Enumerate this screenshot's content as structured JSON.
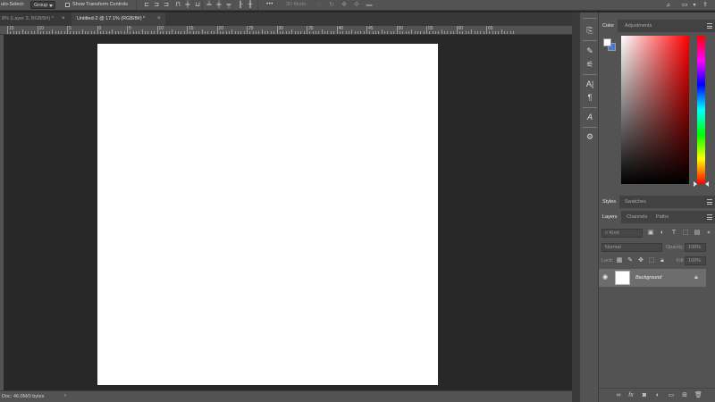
{
  "options_bar": {
    "auto_select_label": "uto-Select:",
    "auto_select_value": "Group",
    "show_transform_label": "Show Transform Controls",
    "more_label": "•••",
    "mode_3d_label": "3D Mode:"
  },
  "tabs": [
    {
      "label": "8% (Layer 3, RGB/8#) *",
      "close": "×",
      "active": false
    },
    {
      "label": "Untitled-2 @ 17.1% (RGB/8#) *",
      "close": "×",
      "active": true
    }
  ],
  "ruler": {
    "labels": [
      "15",
      "10",
      "5",
      "0",
      "5",
      "10",
      "15",
      "20",
      "25",
      "30",
      "35",
      "40",
      "45",
      "50",
      "55",
      "60",
      "65"
    ]
  },
  "status_bar": {
    "doc_info": "Doc: 46.0M/0 bytes",
    "arrow": "›"
  },
  "panels": {
    "top_tabs": {
      "color": "Color",
      "adjustments": "Adjustments"
    },
    "mid_tabs": {
      "styles": "Styles",
      "swatches": "Swatches"
    },
    "layers_tabs": {
      "layers": "Layers",
      "channels": "Channels",
      "paths": "Paths"
    },
    "layers": {
      "kind_placeholder": "Kind",
      "blend_mode": "Normal",
      "opacity_label": "Opacity:",
      "opacity_value": "100%",
      "lock_label": "Lock:",
      "fill_label": "Fill:",
      "fill_value": "100%",
      "layer_name": "Background"
    }
  },
  "colors": {
    "foreground": "#ffffff",
    "background": "#4a78d4",
    "canvas": "#ffffff",
    "workspace": "#282828",
    "panel": "#535353"
  }
}
